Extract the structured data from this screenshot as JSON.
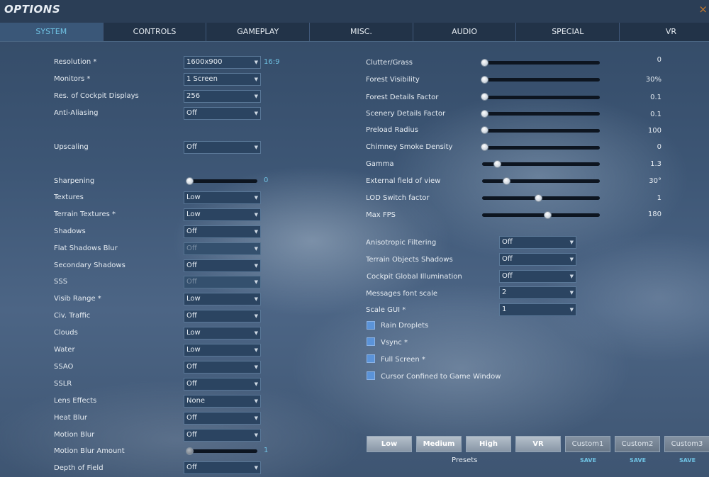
{
  "window": {
    "title": "OPTIONS",
    "close_glyph": "×"
  },
  "tabs": [
    "SYSTEM",
    "CONTROLS",
    "GAMEPLAY",
    "MISC.",
    "AUDIO",
    "SPECIAL",
    "VR"
  ],
  "active_tab": "SYSTEM",
  "left_settings": {
    "resolution": {
      "label": "Resolution *",
      "value": "1600x900",
      "ratio": "16:9"
    },
    "monitors": {
      "label": "Monitors *",
      "value": "1 Screen"
    },
    "cockpit_res": {
      "label": "Res. of Cockpit Displays",
      "value": "256"
    },
    "anti_aliasing": {
      "label": "Anti-Aliasing",
      "value": "Off"
    },
    "upscaling": {
      "label": "Upscaling",
      "value": "Off"
    },
    "sharpening": {
      "label": "Sharpening",
      "value": "0",
      "level": 0
    },
    "textures": {
      "label": "Textures",
      "value": "Low"
    },
    "terrain_textures": {
      "label": "Terrain Textures *",
      "value": "Low"
    },
    "shadows": {
      "label": "Shadows",
      "value": "Off"
    },
    "flat_shadows_blur": {
      "label": "Flat Shadows Blur",
      "value": "Off"
    },
    "secondary_shadows": {
      "label": "Secondary Shadows",
      "value": "Off"
    },
    "sss": {
      "label": "SSS",
      "value": "Off"
    },
    "visib_range": {
      "label": "Visib Range *",
      "value": "Low"
    },
    "civ_traffic": {
      "label": "Civ. Traffic",
      "value": "Off"
    },
    "clouds": {
      "label": "Clouds",
      "value": "Low"
    },
    "water": {
      "label": "Water",
      "value": "Low"
    },
    "ssao": {
      "label": "SSAO",
      "value": "Off"
    },
    "sslr": {
      "label": "SSLR",
      "value": "Off"
    },
    "lens_effects": {
      "label": "Lens Effects",
      "value": "None"
    },
    "heat_blur": {
      "label": "Heat Blur",
      "value": "Off"
    },
    "motion_blur": {
      "label": "Motion Blur",
      "value": "Off"
    },
    "motion_blur_amount": {
      "label": "Motion Blur Amount",
      "value": "1",
      "level": 0
    },
    "depth_of_field": {
      "label": "Depth of Field",
      "value": "Off"
    }
  },
  "right_sliders": {
    "clutter_grass": {
      "label": "Clutter/Grass",
      "value": "0",
      "level": 0
    },
    "forest_visibility": {
      "label": "Forest Visibility",
      "value": "30%",
      "level": 0
    },
    "forest_details": {
      "label": "Forest Details Factor",
      "value": "0.1",
      "level": 0
    },
    "scenery_details": {
      "label": "Scenery Details Factor",
      "value": "0.1",
      "level": 0
    },
    "preload_radius": {
      "label": "Preload Radius",
      "value": "100",
      "level": 0
    },
    "chimney_smoke": {
      "label": "Chimney Smoke Density",
      "value": "0",
      "level": 0
    },
    "gamma": {
      "label": "Gamma",
      "value": "1.3",
      "level": 0.12
    },
    "external_fov": {
      "label": "External field of view",
      "value": "30°",
      "level": 0.2
    },
    "lod_switch": {
      "label": "LOD Switch factor",
      "value": "1",
      "level": 0.47
    },
    "max_fps": {
      "label": "Max FPS",
      "value": "180",
      "level": 0.55
    }
  },
  "right_dropdowns": {
    "anisotropic": {
      "label": "Anisotropic Filtering",
      "value": "Off"
    },
    "terrain_objects_shadows": {
      "label": "Terrain Objects Shadows",
      "value": "Off"
    },
    "cockpit_gi": {
      "label": "Cockpit Global Illumination",
      "value": "Off"
    },
    "messages_font_scale": {
      "label": "Messages font scale",
      "value": "2"
    },
    "scale_gui": {
      "label": "Scale GUI *",
      "value": "1"
    }
  },
  "checkboxes": {
    "rain_droplets": {
      "label": "Rain Droplets",
      "checked": false
    },
    "vsync": {
      "label": "Vsync *",
      "checked": false
    },
    "full_screen": {
      "label": "Full Screen *",
      "checked": false
    },
    "cursor_confined": {
      "label": "Cursor Confined to Game Window",
      "checked": false
    }
  },
  "presets": {
    "label": "Presets",
    "buttons": [
      "Low",
      "Medium",
      "High",
      "VR"
    ],
    "custom": [
      "Custom1",
      "Custom2",
      "Custom3"
    ],
    "save_label": "SAVE"
  },
  "colors": {
    "accent": "#6fc2e3",
    "checkbox": "#5b93d8",
    "close": "#c57a2e"
  }
}
